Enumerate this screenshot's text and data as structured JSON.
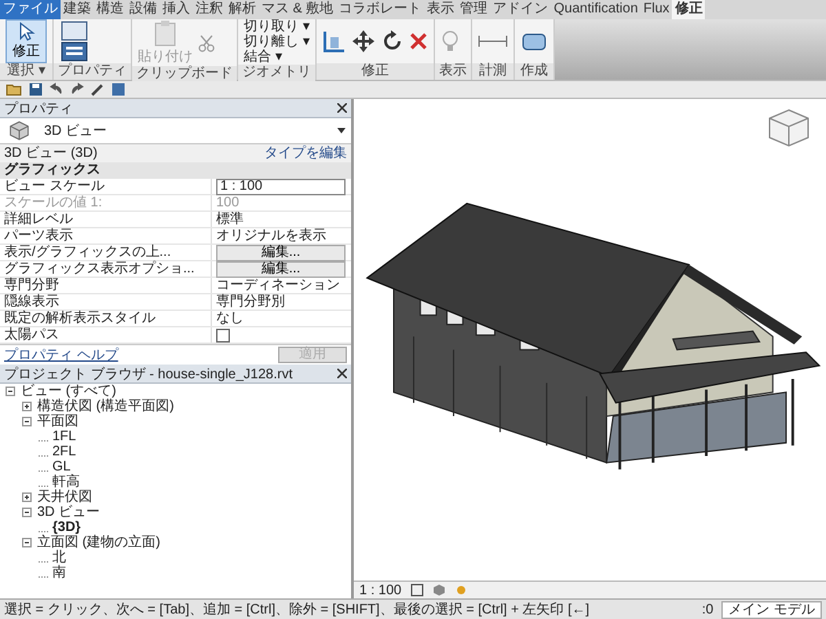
{
  "ribbon_tabs": [
    {
      "label": "ファイル",
      "selected": false,
      "kind": "file"
    },
    {
      "label": "建築",
      "selected": false,
      "kind": "tab"
    },
    {
      "label": "構造",
      "selected": false,
      "kind": "tab"
    },
    {
      "label": "設備",
      "selected": false,
      "kind": "tab"
    },
    {
      "label": "挿入",
      "selected": false,
      "kind": "tab"
    },
    {
      "label": "注釈",
      "selected": false,
      "kind": "tab"
    },
    {
      "label": "解析",
      "selected": false,
      "kind": "tab"
    },
    {
      "label": "マス & 敷地",
      "selected": false,
      "kind": "tab"
    },
    {
      "label": "コラボレート",
      "selected": false,
      "kind": "tab"
    },
    {
      "label": "表示",
      "selected": false,
      "kind": "tab"
    },
    {
      "label": "管理",
      "selected": false,
      "kind": "tab"
    },
    {
      "label": "アドイン",
      "selected": false,
      "kind": "tab"
    },
    {
      "label": "Quantification",
      "selected": false,
      "kind": "tab"
    },
    {
      "label": "Flux",
      "selected": false,
      "kind": "tab"
    },
    {
      "label": "修正",
      "selected": true,
      "kind": "tab"
    }
  ],
  "ribbon": {
    "modify_button": "修正",
    "select_menu": "選択 ▾",
    "panels": [
      {
        "kind": "properties",
        "label": "プロパティ"
      },
      {
        "kind": "clipboard",
        "label": "クリップボード",
        "paste": "貼り付け"
      },
      {
        "kind": "geometry",
        "label": "ジオメトリ",
        "tools": [
          "切り取り ▾",
          "切り離し ▾",
          "結合 ▾"
        ]
      },
      {
        "kind": "modify",
        "label": "修正"
      },
      {
        "kind": "view",
        "label": "表示"
      },
      {
        "kind": "measure",
        "label": "計測"
      },
      {
        "kind": "create",
        "label": "作成"
      }
    ]
  },
  "properties": {
    "title": "プロパティ",
    "type_name": "3D ビュー",
    "instance": "3D ビュー (3D)",
    "edit_type": "タイプを編集",
    "category": "グラフィックス",
    "rows": [
      {
        "kind": "field",
        "label": "ビュー スケール",
        "value": "1 : 100"
      },
      {
        "kind": "readonly",
        "label": "スケールの値  1:",
        "value": "100"
      },
      {
        "kind": "text",
        "label": "詳細レベル",
        "value": "標準"
      },
      {
        "kind": "text",
        "label": "パーツ表示",
        "value": "オリジナルを表示"
      },
      {
        "kind": "button",
        "label": "表示/グラフィックスの上...",
        "value": "編集..."
      },
      {
        "kind": "button",
        "label": "グラフィックス表示オプショ...",
        "value": "編集..."
      },
      {
        "kind": "text",
        "label": "専門分野",
        "value": "コーディネーション"
      },
      {
        "kind": "text",
        "label": "隠線表示",
        "value": "専門分野別"
      },
      {
        "kind": "text",
        "label": "既定の解析表示スタイル",
        "value": "なし"
      },
      {
        "kind": "checkbox",
        "label": "太陽パス",
        "checked": false
      }
    ],
    "help_link": "プロパティ ヘルプ",
    "apply": {
      "label": "適用",
      "disabled": true
    }
  },
  "project_browser": {
    "title": "プロジェクト ブラウザ - house-single_J128.rvt",
    "tree": [
      {
        "label": "ビュー (すべて)",
        "expanded": true,
        "children": [
          {
            "label": "構造伏図 (構造平面図)",
            "expanded": false
          },
          {
            "label": "平面図",
            "expanded": true,
            "children": [
              {
                "label": "1FL",
                "selected": false
              },
              {
                "label": "2FL",
                "selected": false
              },
              {
                "label": "GL",
                "selected": false
              },
              {
                "label": "軒高",
                "selected": false
              }
            ]
          },
          {
            "label": "天井伏図",
            "expanded": false
          },
          {
            "label": "3D ビュー",
            "expanded": true,
            "children": [
              {
                "label": "{3D}",
                "selected": true
              }
            ]
          },
          {
            "label": "立面図 (建物の立面)",
            "expanded": true,
            "children": [
              {
                "label": "北",
                "selected": false
              },
              {
                "label": "南",
                "selected": false
              }
            ]
          }
        ]
      }
    ]
  },
  "view_bar": {
    "scale": "1 : 100"
  },
  "status_bar": {
    "message": "選択 = クリック、次へ = [Tab]、追加 = [Ctrl]、除外 = [SHIFT]、最後の選択 = [Ctrl] + 左矢印 [←]",
    "workset": ":0",
    "model": "メイン モデル"
  }
}
